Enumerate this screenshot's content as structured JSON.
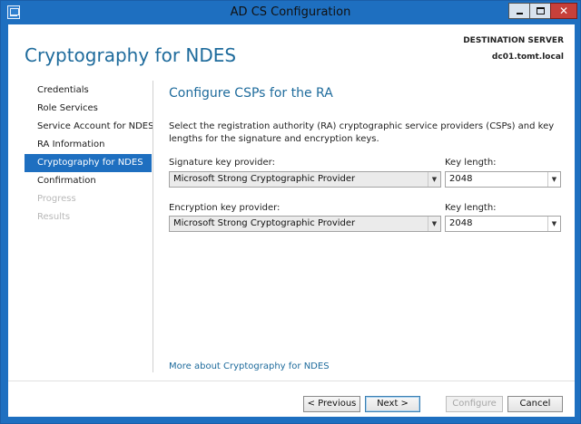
{
  "window": {
    "title": "AD CS Configuration",
    "accent_color": "#1e6fc0",
    "controls": {
      "minimize_icon": "minimize-icon",
      "maximize_icon": "maximize-icon",
      "close_icon": "close-icon",
      "close_glyph": "✕"
    }
  },
  "header": {
    "page_title": "Cryptography for NDES",
    "destination_label": "DESTINATION SERVER",
    "destination_server": "dc01.tomt.local"
  },
  "sidebar": {
    "items": [
      {
        "label": "Credentials",
        "state": "normal"
      },
      {
        "label": "Role Services",
        "state": "normal"
      },
      {
        "label": "Service Account for NDES",
        "state": "normal"
      },
      {
        "label": "RA Information",
        "state": "normal"
      },
      {
        "label": "Cryptography for NDES",
        "state": "selected"
      },
      {
        "label": "Confirmation",
        "state": "normal"
      },
      {
        "label": "Progress",
        "state": "disabled"
      },
      {
        "label": "Results",
        "state": "disabled"
      }
    ]
  },
  "main": {
    "heading": "Configure CSPs for the RA",
    "description": "Select the registration authority (RA) cryptographic service providers (CSPs) and key lengths for the signature and encryption keys.",
    "signature": {
      "provider_label": "Signature key provider:",
      "provider_value": "Microsoft Strong Cryptographic Provider",
      "key_length_label": "Key length:",
      "key_length_value": "2048"
    },
    "encryption": {
      "provider_label": "Encryption key provider:",
      "provider_value": "Microsoft Strong Cryptographic Provider",
      "key_length_label": "Key length:",
      "key_length_value": "2048"
    },
    "more_link": "More about Cryptography for NDES"
  },
  "footer": {
    "previous": "< Previous",
    "next": "Next >",
    "configure": "Configure",
    "cancel": "Cancel"
  }
}
